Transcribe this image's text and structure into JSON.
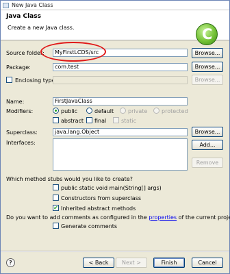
{
  "window": {
    "title": "New Java Class"
  },
  "banner": {
    "heading": "Java Class",
    "description": "Create a new Java class.",
    "logo_glyph": "C"
  },
  "form": {
    "source_folder": {
      "label": "Source folder:",
      "value": "MyFirstLCDS/src",
      "browse": "Browse..."
    },
    "package": {
      "label": "Package:",
      "value": "com.test",
      "browse": "Browse..."
    },
    "enclosing_type": {
      "label": "Enclosing type:",
      "value": "",
      "browse": "Browse...",
      "checked": false
    },
    "name": {
      "label": "Name:",
      "value": "FirstJavaClass"
    },
    "modifiers": {
      "label": "Modifiers:",
      "public": "public",
      "default": "default",
      "private": "private",
      "protected": "protected",
      "abstract": "abstract",
      "final": "final",
      "static": "static",
      "selected": "public"
    },
    "superclass": {
      "label": "Superclass:",
      "value": "java.lang.Object",
      "browse": "Browse..."
    },
    "interfaces": {
      "label": "Interfaces:",
      "add": "Add...",
      "remove": "Remove"
    }
  },
  "stubs": {
    "question": "Which method stubs would you like to create?",
    "main": {
      "label": "public static void main(String[] args)",
      "checked": false
    },
    "constructors": {
      "label": "Constructors from superclass",
      "checked": false
    },
    "inherited": {
      "label": "Inherited abstract methods",
      "checked": true
    }
  },
  "comments": {
    "question_before": "Do you want to add comments as configured in the",
    "link": "properties",
    "question_after": "of the current project?",
    "generate": {
      "label": "Generate comments",
      "checked": false
    }
  },
  "footer": {
    "help_glyph": "?",
    "back": "< Back",
    "next": "Next >",
    "finish": "Finish",
    "cancel": "Cancel"
  },
  "colors": {
    "highlight_oval": "#e01818",
    "logo_green": "#74c236",
    "check_green": "#21a121"
  }
}
